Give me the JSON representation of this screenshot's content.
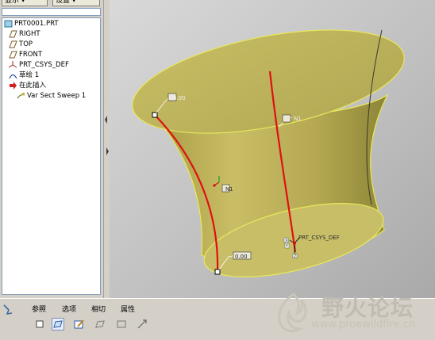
{
  "top_buttons": [
    "显示 ▾",
    "设置 ▾"
  ],
  "tree": {
    "root": "PRT0001.PRT",
    "items": [
      {
        "label": "RIGHT",
        "icon": "datum-plane-icon"
      },
      {
        "label": "TOP",
        "icon": "datum-plane-icon"
      },
      {
        "label": "FRONT",
        "icon": "datum-plane-icon"
      },
      {
        "label": "PRT_CSYS_DEF",
        "icon": "csys-icon"
      },
      {
        "label": "草绘 1",
        "icon": "sketch-icon"
      },
      {
        "label": "在此插入",
        "icon": "insert-here-arrow-icon"
      },
      {
        "label": "Var Sect Sweep 1",
        "icon": "sweep-feature-icon"
      }
    ]
  },
  "viewport": {
    "labels": {
      "top_point": "0.00",
      "trajectory": "N1",
      "sketch": "N1",
      "bottom_point": "0.00",
      "csys": "PRT_CSYS_DEF",
      "axis_x": "X",
      "axis_y": "Y",
      "axis_z": "Z"
    },
    "colors": {
      "background": "#bdbdbd",
      "surface": "#bdb35c",
      "edge": "#e8e85a",
      "trajectory": "#e01010"
    }
  },
  "bottom": {
    "tabs": [
      "参照",
      "选项",
      "相切",
      "属性"
    ],
    "tools": [
      "solid-icon",
      "surface-icon",
      "sketch-edit-icon",
      "remove-material-icon",
      "thicken-icon",
      "pause-icon"
    ]
  },
  "watermark": {
    "title": "野火论坛",
    "url": "www.proewildfire.cn"
  }
}
